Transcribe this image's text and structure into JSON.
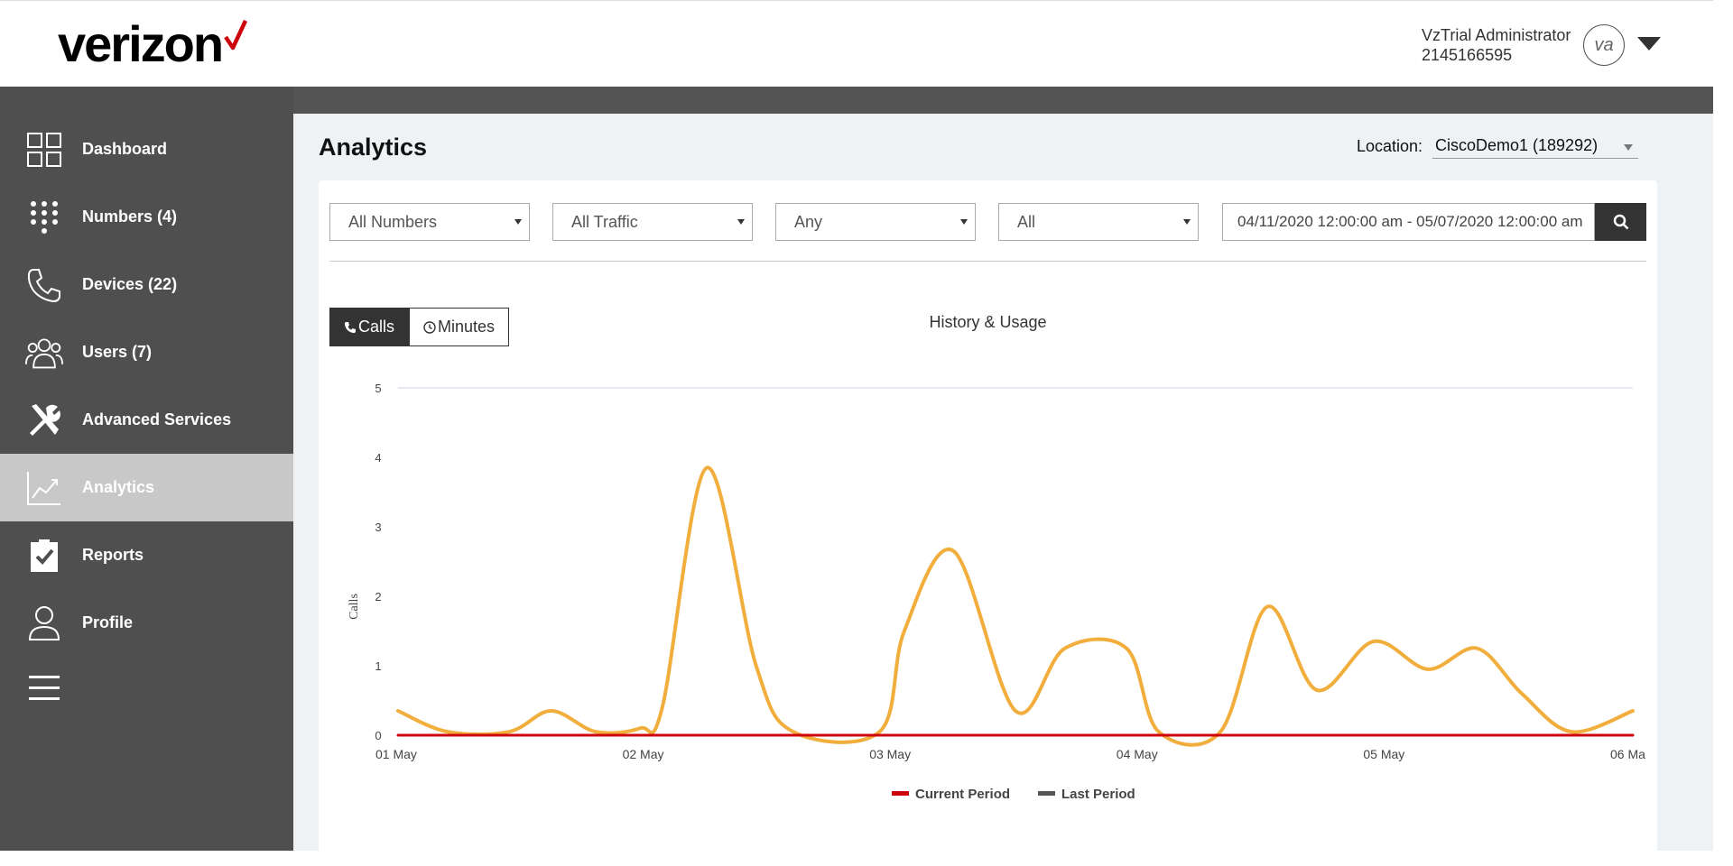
{
  "header": {
    "logo_text": "verizon",
    "user_name": "VzTrial Administrator",
    "user_phone": "2145166595",
    "avatar_initials": "va"
  },
  "sidebar": {
    "items": [
      {
        "label": "Dashboard",
        "icon": "grid-icon"
      },
      {
        "label": "Numbers (4)",
        "icon": "dialpad-icon"
      },
      {
        "label": "Devices (22)",
        "icon": "phone-icon"
      },
      {
        "label": "Users (7)",
        "icon": "users-icon"
      },
      {
        "label": "Advanced Services",
        "icon": "tools-icon"
      },
      {
        "label": "Analytics",
        "icon": "chart-line-icon",
        "active": true
      },
      {
        "label": "Reports",
        "icon": "clipboard-check-icon"
      },
      {
        "label": "Profile",
        "icon": "person-icon"
      }
    ],
    "menu_icon": "hamburger-icon"
  },
  "page": {
    "title": "Analytics",
    "location_label": "Location:",
    "location_value": "CiscoDemo1 (189292)"
  },
  "filters": {
    "numbers": "All Numbers",
    "traffic": "All Traffic",
    "direction": "Any",
    "type": "All",
    "date_range": "04/11/2020 12:00:00 am - 05/07/2020 12:00:00 am"
  },
  "toggles": {
    "calls": "Calls",
    "minutes": "Minutes"
  },
  "colors": {
    "accent": "#cd040b",
    "series_history": "#f2ae3d",
    "sidebar_bg": "#4f4f4f"
  },
  "chart_data": {
    "type": "line",
    "title": "History & Usage",
    "ylabel": "Calls",
    "ylim": [
      0,
      5
    ],
    "yticks": [
      "0",
      "1",
      "2",
      "3",
      "4",
      "5"
    ],
    "xticks": [
      "01 May",
      "02 May",
      "03 May",
      "04 May",
      "05 May",
      "06 Ma"
    ],
    "xlim_days": [
      0,
      5
    ],
    "series": [
      {
        "color": "#f2ae3d",
        "points": [
          [
            0.0,
            0.35
          ],
          [
            0.2,
            0.05
          ],
          [
            0.45,
            0.05
          ],
          [
            0.62,
            0.35
          ],
          [
            0.8,
            0.05
          ],
          [
            0.98,
            0.1
          ],
          [
            1.07,
            0.4
          ],
          [
            1.25,
            3.85
          ],
          [
            1.45,
            1.0
          ],
          [
            1.6,
            0.05
          ],
          [
            1.95,
            0.05
          ],
          [
            2.05,
            1.5
          ],
          [
            2.25,
            2.65
          ],
          [
            2.5,
            0.35
          ],
          [
            2.7,
            1.25
          ],
          [
            2.95,
            1.25
          ],
          [
            3.08,
            0.05
          ],
          [
            3.33,
            0.05
          ],
          [
            3.52,
            1.85
          ],
          [
            3.72,
            0.65
          ],
          [
            3.95,
            1.35
          ],
          [
            4.17,
            0.95
          ],
          [
            4.37,
            1.25
          ],
          [
            4.55,
            0.6
          ],
          [
            4.75,
            0.05
          ],
          [
            5.0,
            0.35
          ]
        ]
      },
      {
        "name": "Current Period",
        "color": "#cd040b",
        "points": [
          [
            0,
            0
          ],
          [
            5,
            0
          ]
        ]
      }
    ],
    "legend": [
      {
        "name": "Current Period",
        "color": "#cd040b"
      },
      {
        "name": "Last Period",
        "color": "#555555"
      }
    ],
    "legend_position": "bottom-center"
  }
}
